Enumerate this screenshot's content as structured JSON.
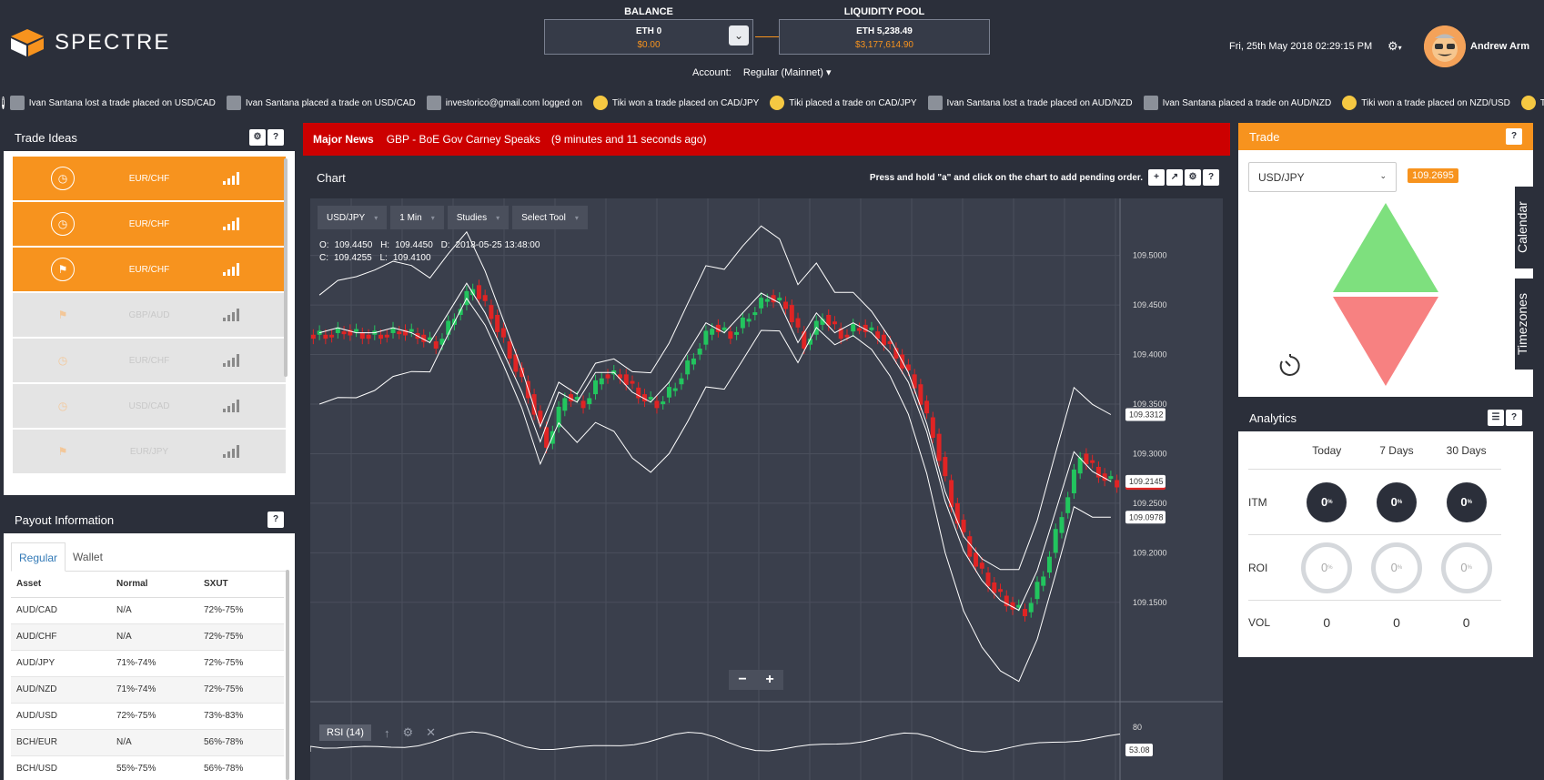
{
  "app": {
    "name": "SPECTRE"
  },
  "balance": {
    "label": "BALANCE",
    "eth": "ETH 0",
    "usd": "$0.00"
  },
  "pool": {
    "label": "LIQUIDITY POOL",
    "eth": "ETH 5,238.49",
    "usd": "$3,177,614.90"
  },
  "account": {
    "label": "Account:",
    "value": "Regular (Mainnet)"
  },
  "datetime": "Fri, 25th May 2018 02:29:15 PM",
  "user": {
    "name": "Andrew Arm"
  },
  "ticker": [
    {
      "icon": "user-avatar-icon",
      "text": "Ivan Santana lost a trade placed on USD/CAD"
    },
    {
      "icon": "user-avatar-icon",
      "text": "Ivan Santana placed a trade on USD/CAD"
    },
    {
      "icon": "user-avatar-icon",
      "text": "investorico@gmail.com logged on"
    },
    {
      "icon": "coin-avatar-icon",
      "text": "Tiki won a trade placed on CAD/JPY"
    },
    {
      "icon": "coin-avatar-icon",
      "text": "Tiki placed a trade on CAD/JPY"
    },
    {
      "icon": "user-avatar-icon",
      "text": "Ivan Santana lost a trade placed on AUD/NZD"
    },
    {
      "icon": "user-avatar-icon",
      "text": "Ivan Santana placed a trade on AUD/NZD"
    },
    {
      "icon": "coin-avatar-icon",
      "text": "Tiki won a trade placed on NZD/USD"
    },
    {
      "icon": "coin-avatar-icon",
      "text": "Tiki w"
    }
  ],
  "trade_ideas": {
    "title": "Trade Ideas",
    "items": [
      {
        "pair": "EUR/CHF",
        "active": true,
        "icon": "clock-icon"
      },
      {
        "pair": "EUR/CHF",
        "active": true,
        "icon": "clock-icon"
      },
      {
        "pair": "EUR/CHF",
        "active": true,
        "icon": "flag-icon"
      },
      {
        "pair": "GBP/AUD",
        "active": false,
        "icon": "flag-icon"
      },
      {
        "pair": "EUR/CHF",
        "active": false,
        "icon": "clock-icon"
      },
      {
        "pair": "USD/CAD",
        "active": false,
        "icon": "clock-icon"
      },
      {
        "pair": "EUR/JPY",
        "active": false,
        "icon": "flag-icon"
      }
    ]
  },
  "payout": {
    "title": "Payout Information",
    "tabs": [
      "Regular",
      "Wallet"
    ],
    "headers": [
      "Asset",
      "Normal",
      "SXUT"
    ],
    "rows": [
      [
        "AUD/CAD",
        "N/A",
        "72%-75%"
      ],
      [
        "AUD/CHF",
        "N/A",
        "72%-75%"
      ],
      [
        "AUD/JPY",
        "71%-74%",
        "72%-75%"
      ],
      [
        "AUD/NZD",
        "71%-74%",
        "72%-75%"
      ],
      [
        "AUD/USD",
        "72%-75%",
        "73%-83%"
      ],
      [
        "BCH/EUR",
        "N/A",
        "56%-78%"
      ],
      [
        "BCH/USD",
        "55%-75%",
        "56%-78%"
      ]
    ]
  },
  "news": {
    "label": "Major News",
    "title": "GBP - BoE Gov Carney Speaks",
    "when": "(9 minutes and 11 seconds ago)"
  },
  "chart": {
    "title": "Chart",
    "hint": "Press and hold \"a\" and click on the chart to add pending order.",
    "toolbar": [
      "USD/JPY",
      "1 Min",
      "Studies",
      "Select Tool"
    ],
    "ohlc": {
      "o_label": "O:",
      "o": "109.4450",
      "h_label": "H:",
      "h": "109.4450",
      "d_label": "D:",
      "d": "2018-05-25 13:48:00",
      "c_label": "C:",
      "c": "109.4255",
      "l_label": "L:",
      "l": "109.4100"
    },
    "rsi_label": "RSI (14)"
  },
  "chart_data": {
    "type": "line",
    "title": "",
    "xlabel": "",
    "ylabel": "",
    "ylim": [
      109.08,
      109.53
    ],
    "y_ticks": [
      "109.5000",
      "109.4500",
      "109.4000",
      "109.3500",
      "109.3000",
      "109.2500",
      "109.2000",
      "109.1500"
    ],
    "price_labels": {
      "upper_band": "109.3312",
      "current": "109.2695",
      "middle_band": "109.2145",
      "lower_band": "109.0978"
    },
    "rsi": {
      "level_label": "80",
      "value_label": "53.08"
    },
    "series": [
      {
        "values": [
          109.42,
          109.425,
          109.42,
          109.42,
          109.425,
          109.42,
          109.41,
          109.44,
          109.47,
          109.44,
          109.4,
          109.36,
          109.31,
          109.36,
          109.35,
          109.38,
          109.38,
          109.36,
          109.35,
          109.37,
          109.4,
          109.43,
          109.42,
          109.44,
          109.46,
          109.45,
          109.41,
          109.44,
          109.42,
          109.43,
          109.42,
          109.4,
          109.37,
          109.32,
          109.25,
          109.2,
          109.17,
          109.15,
          109.14,
          109.18,
          109.24,
          109.3,
          109.28,
          109.27
        ]
      }
    ]
  },
  "trade": {
    "title": "Trade",
    "pair": "USD/JPY",
    "price": "109.2695"
  },
  "side_tabs": [
    "Calendar",
    "Timezones"
  ],
  "analytics": {
    "title": "Analytics",
    "columns": [
      "Today",
      "7 Days",
      "30 Days"
    ],
    "itm_label": "ITM",
    "itm": [
      "0",
      "0",
      "0"
    ],
    "roi_label": "ROI",
    "roi": [
      "0",
      "0",
      "0"
    ],
    "vol_label": "VOL",
    "vol": [
      "0",
      "0",
      "0"
    ],
    "unit": "%"
  },
  "colors": {
    "accent": "#f7931e",
    "bg": "#2b2f3a",
    "news": "#cc0000",
    "up": "#22c55e",
    "down": "#e02424"
  }
}
